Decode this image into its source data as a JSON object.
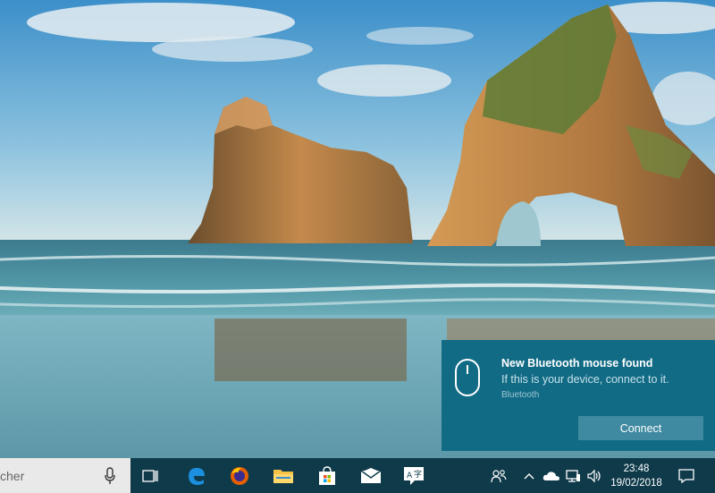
{
  "notification": {
    "title": "New Bluetooth mouse found",
    "body": "If this is your device, connect to it.",
    "attribution": "Bluetooth",
    "action_label": "Connect",
    "icon": "mouse-icon",
    "background": "#126b85"
  },
  "taskbar": {
    "search_text": "cher",
    "search_icon": "microphone-icon",
    "apps": [
      {
        "name": "task-view",
        "icon": "task-view-icon"
      },
      {
        "name": "edge",
        "icon": "edge-icon"
      },
      {
        "name": "firefox",
        "icon": "firefox-icon"
      },
      {
        "name": "file-explorer",
        "icon": "folder-icon"
      },
      {
        "name": "store",
        "icon": "store-bag-icon"
      },
      {
        "name": "mail",
        "icon": "mail-icon"
      },
      {
        "name": "ime",
        "icon": "ime-icon"
      }
    ],
    "tray": {
      "icons": [
        "people-icon",
        "chevron-up-icon",
        "onedrive-icon",
        "network-icon",
        "volume-icon"
      ],
      "time": "23:48",
      "date": "19/02/2018",
      "notification_icon": "action-center-icon"
    },
    "color": "#0f3a4a"
  }
}
